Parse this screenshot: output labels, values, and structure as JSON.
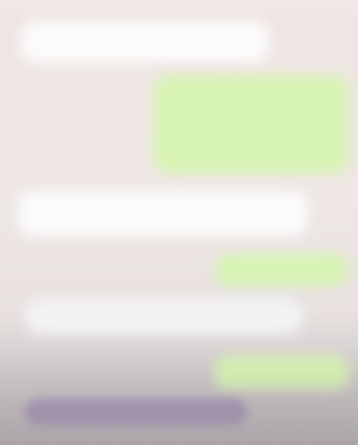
{
  "chat": {
    "messages": [
      {
        "direction": "incoming",
        "lines": [
          "",
          ""
        ]
      },
      {
        "direction": "outgoing",
        "lines": [
          "",
          "",
          "",
          ""
        ]
      },
      {
        "direction": "incoming",
        "lines": [
          "",
          ""
        ]
      },
      {
        "direction": "outgoing",
        "lines": [
          ""
        ]
      },
      {
        "direction": "incoming",
        "lines": [
          ""
        ]
      },
      {
        "direction": "outgoing",
        "lines": [
          ""
        ]
      }
    ]
  },
  "colors": {
    "background": "#ece5dd",
    "incoming_bubble": "#fbfbfb",
    "outgoing_bubble": "#d7f4b3",
    "bottom_bar": "#9e8fb2"
  }
}
